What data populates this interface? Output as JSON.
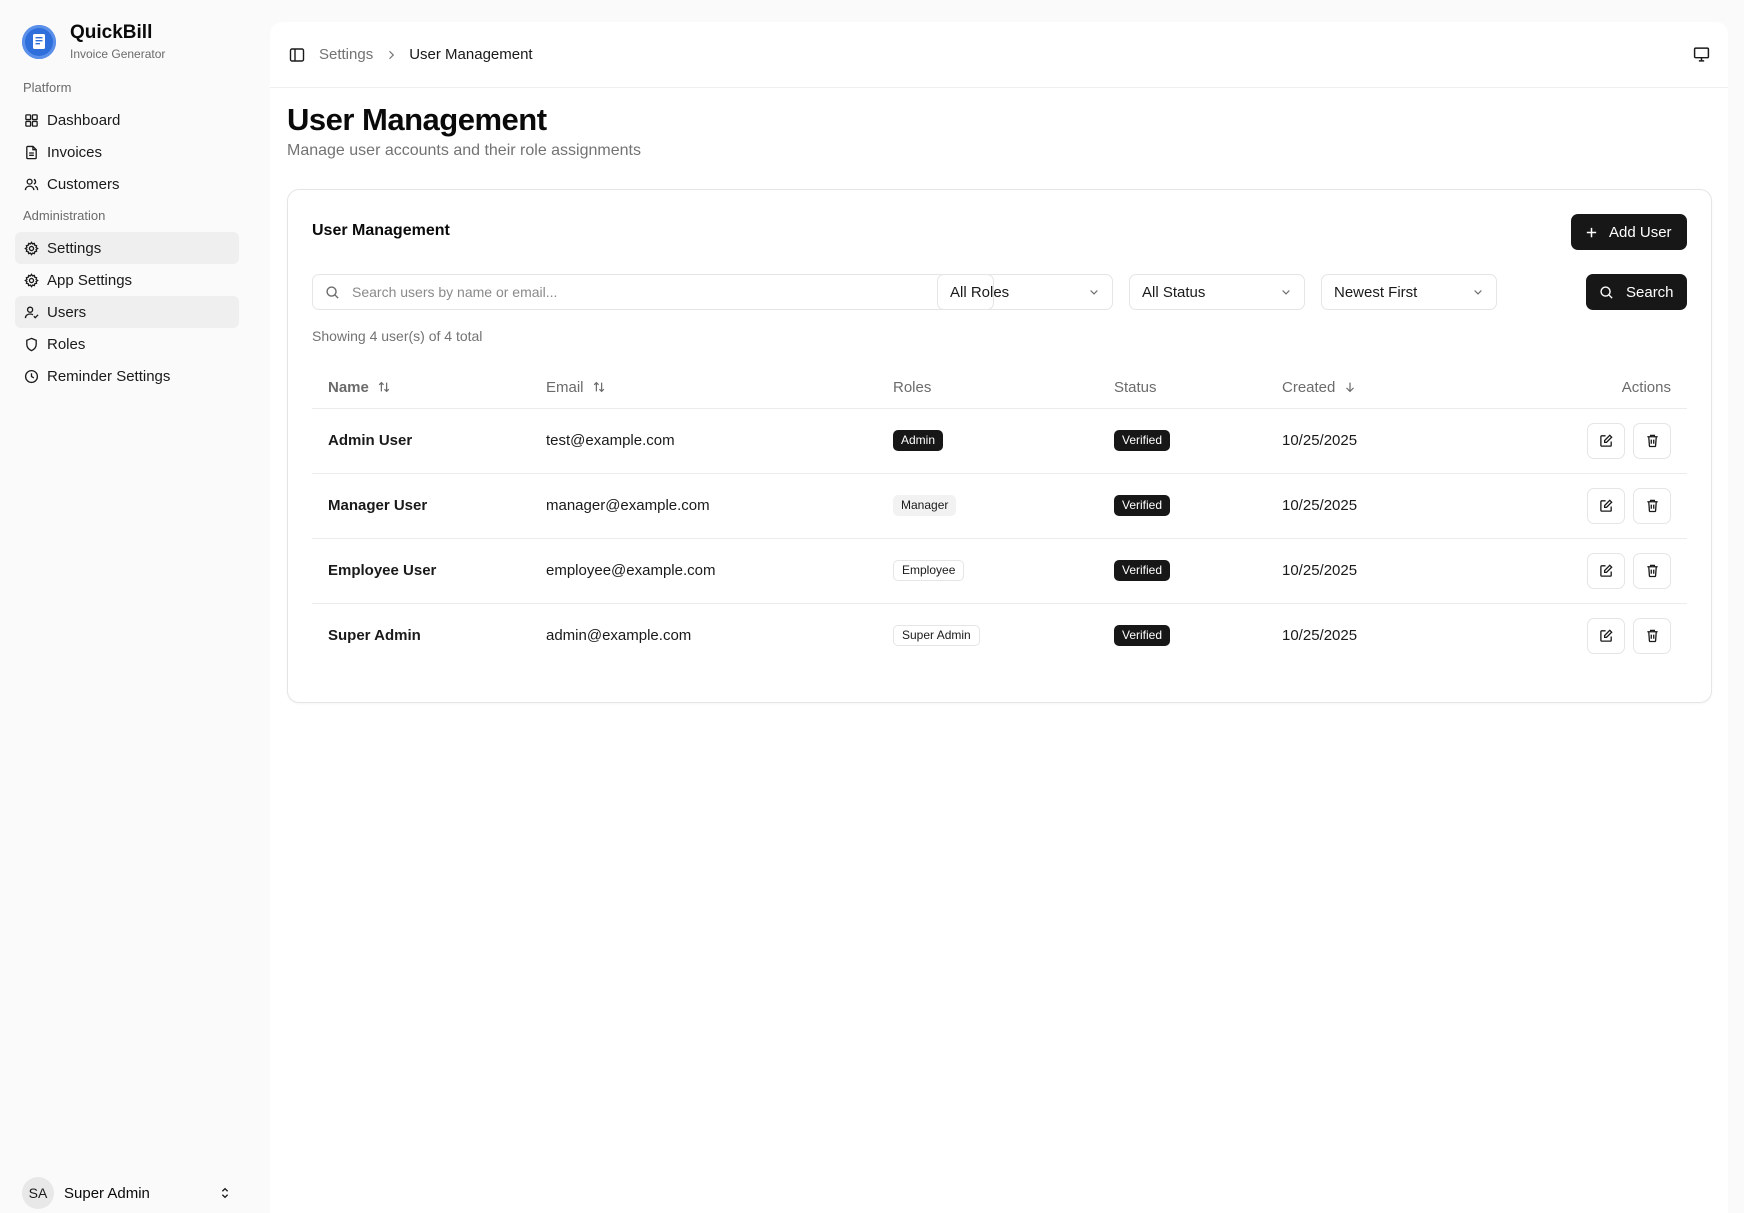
{
  "app": {
    "name": "QuickBill",
    "subtitle": "Invoice Generator"
  },
  "sidebar": {
    "groups": [
      {
        "label": "Platform",
        "items": [
          {
            "label": "Dashboard",
            "icon": "grid-icon"
          },
          {
            "label": "Invoices",
            "icon": "file-text-icon"
          },
          {
            "label": "Customers",
            "icon": "users-icon"
          }
        ]
      },
      {
        "label": "Administration",
        "items": [
          {
            "label": "Settings",
            "icon": "gear-icon",
            "active": true
          },
          {
            "label": "App Settings",
            "icon": "gear-icon"
          },
          {
            "label": "Users",
            "icon": "user-check-icon",
            "active": true
          },
          {
            "label": "Roles",
            "icon": "shield-icon"
          },
          {
            "label": "Reminder Settings",
            "icon": "clock-icon"
          }
        ]
      }
    ],
    "user": {
      "initials": "SA",
      "name": "Super Admin"
    }
  },
  "breadcrumb": {
    "parent": "Settings",
    "current": "User Management"
  },
  "page": {
    "title": "User Management",
    "subtitle": "Manage user accounts and their role assignments"
  },
  "card": {
    "title": "User Management",
    "add_button": "Add User",
    "search_placeholder": "Search users by name or email...",
    "filters": {
      "roles": "All Roles",
      "status": "All Status",
      "sort": "Newest First"
    },
    "search_button": "Search",
    "count_text": "Showing 4 user(s) of 4 total"
  },
  "table": {
    "columns": {
      "name": "Name",
      "email": "Email",
      "roles": "Roles",
      "status": "Status",
      "created": "Created",
      "actions": "Actions"
    },
    "rows": [
      {
        "name": "Admin User",
        "email": "test@example.com",
        "role": "Admin",
        "role_style": "dark",
        "status": "Verified",
        "created": "10/25/2025"
      },
      {
        "name": "Manager User",
        "email": "manager@example.com",
        "role": "Manager",
        "role_style": "light",
        "status": "Verified",
        "created": "10/25/2025"
      },
      {
        "name": "Employee User",
        "email": "employee@example.com",
        "role": "Employee",
        "role_style": "outline",
        "status": "Verified",
        "created": "10/25/2025"
      },
      {
        "name": "Super Admin",
        "email": "admin@example.com",
        "role": "Super Admin",
        "role_style": "outline",
        "status": "Verified",
        "created": "10/25/2025"
      }
    ]
  },
  "colors": {
    "brand": "#2f6fdc",
    "primary_button": "#171717",
    "muted_text": "#737373"
  }
}
